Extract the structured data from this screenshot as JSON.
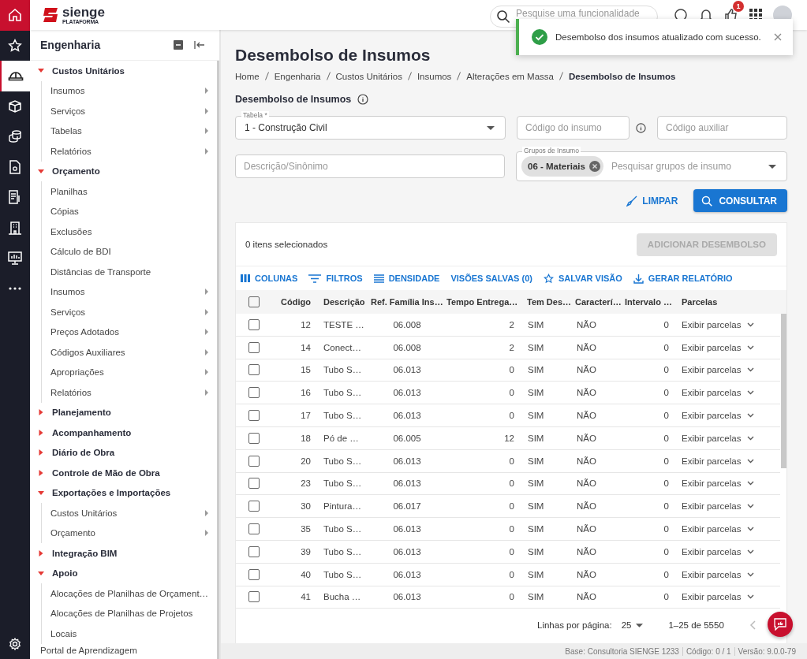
{
  "header": {
    "brand": "sienge",
    "brand_sub": "PLATAFORMA",
    "search": {
      "placeholder": "Pesquise uma funcionalidade"
    },
    "notification_badge": "1"
  },
  "rail": {
    "items": [
      {
        "selected": false
      },
      {
        "selected": false
      },
      {
        "selected": true
      },
      {
        "selected": false
      },
      {
        "selected": false
      },
      {
        "selected": false
      },
      {
        "selected": false
      },
      {
        "selected": false
      },
      {
        "selected": false
      },
      {
        "selected": false
      }
    ]
  },
  "sidebar": {
    "title": "Engenharia",
    "groups": [
      {
        "label": "Custos Unitários",
        "expanded": true,
        "children": [
          {
            "label": "Insumos",
            "has_submenu": true
          },
          {
            "label": "Serviços",
            "has_submenu": true
          },
          {
            "label": "Tabelas",
            "has_submenu": true
          },
          {
            "label": "Relatórios",
            "has_submenu": true
          }
        ]
      },
      {
        "label": "Orçamento",
        "expanded": true,
        "children": [
          {
            "label": "Planilhas",
            "has_submenu": false
          },
          {
            "label": "Cópias",
            "has_submenu": false
          },
          {
            "label": "Exclusões",
            "has_submenu": false
          },
          {
            "label": "Cálculo de BDI",
            "has_submenu": false
          },
          {
            "label": "Distâncias de Transporte",
            "has_submenu": false
          },
          {
            "label": "Insumos",
            "has_submenu": true
          },
          {
            "label": "Serviços",
            "has_submenu": true
          },
          {
            "label": "Preços Adotados",
            "has_submenu": true
          },
          {
            "label": "Códigos Auxiliares",
            "has_submenu": true
          },
          {
            "label": "Apropriações",
            "has_submenu": true
          },
          {
            "label": "Relatórios",
            "has_submenu": true
          }
        ]
      },
      {
        "label": "Planejamento",
        "expanded": false
      },
      {
        "label": "Acompanhamento",
        "expanded": false
      },
      {
        "label": "Diário de Obra",
        "expanded": false
      },
      {
        "label": "Controle de Mão de Obra",
        "expanded": false
      },
      {
        "label": "Exportações e Importações",
        "expanded": true,
        "children": [
          {
            "label": "Custos Unitários",
            "has_submenu": true
          },
          {
            "label": "Orçamento",
            "has_submenu": true
          }
        ]
      },
      {
        "label": "Integração BIM",
        "expanded": false
      },
      {
        "label": "Apoio",
        "expanded": true,
        "children": [
          {
            "label": "Alocações de Planilhas de Orçament…",
            "has_submenu": false
          },
          {
            "label": "Alocações de Planilhas de Projetos",
            "has_submenu": false
          },
          {
            "label": "Locais",
            "has_submenu": false
          }
        ]
      }
    ],
    "footer_link": "Portal de Aprendizagem"
  },
  "toast": {
    "message": "Desembolso dos insumos atualizado com sucesso."
  },
  "page": {
    "title": "Desembolso de Insumos",
    "breadcrumb": [
      {
        "label": "Home",
        "current": false
      },
      {
        "label": "Engenharia",
        "current": false
      },
      {
        "label": "Custos Unitários",
        "current": false
      },
      {
        "label": "Insumos",
        "current": false
      },
      {
        "label": "Alterações em Massa",
        "current": false
      },
      {
        "label": "Desembolso de Insumos",
        "current": true
      }
    ],
    "section_title": "Desembolso de Insumos"
  },
  "form": {
    "table_select": {
      "label": "Tabela *",
      "value": "1 - Construção Civil"
    },
    "item_code": {
      "placeholder": "Código do insumo"
    },
    "aux_code": {
      "placeholder": "Código auxiliar"
    },
    "description": {
      "placeholder": "Descrição/Sinônimo"
    },
    "groups": {
      "label": "Grupos de Insumo",
      "chips": [
        "06 - Materiais"
      ],
      "placeholder": "Pesquisar grupos de insumo"
    },
    "clear_button": "LIMPAR",
    "search_button": "CONSULTAR"
  },
  "table": {
    "selection_text": "0 itens selecionados",
    "add_button": {
      "label": "ADICIONAR DESEMBOLSO",
      "disabled": true
    },
    "toolbar": [
      "COLUNAS",
      "FILTROS",
      "DENSIDADE",
      "VISÕES SALVAS (0)",
      "SALVAR VISÃO",
      "GERAR RELATÓRIO"
    ],
    "select_all_checked": false,
    "columns": [
      "Código",
      "Descrição",
      "Ref. Família Ins…",
      "Tempo Entrega…",
      "Tem Des…",
      "Caracterí…",
      "Intervalo …",
      "Parcelas"
    ],
    "rows": [
      {
        "checked": false,
        "cells": [
          "12",
          "TESTE …",
          "06.008",
          "2",
          "SIM",
          "NÃO",
          "0",
          "Exibir parcelas"
        ]
      },
      {
        "checked": false,
        "cells": [
          "14",
          "Conect…",
          "06.008",
          "2",
          "SIM",
          "NÃO",
          "0",
          "Exibir parcelas"
        ]
      },
      {
        "checked": false,
        "cells": [
          "15",
          "Tubo S…",
          "06.013",
          "0",
          "SIM",
          "NÃO",
          "0",
          "Exibir parcelas"
        ]
      },
      {
        "checked": false,
        "cells": [
          "16",
          "Tubo S…",
          "06.013",
          "0",
          "SIM",
          "NÃO",
          "0",
          "Exibir parcelas"
        ]
      },
      {
        "checked": false,
        "cells": [
          "17",
          "Tubo S…",
          "06.013",
          "0",
          "SIM",
          "NÃO",
          "0",
          "Exibir parcelas"
        ]
      },
      {
        "checked": false,
        "cells": [
          "18",
          "Pó de …",
          "06.005",
          "12",
          "SIM",
          "NÃO",
          "0",
          "Exibir parcelas"
        ]
      },
      {
        "checked": false,
        "cells": [
          "20",
          "Tubo S…",
          "06.013",
          "0",
          "SIM",
          "NÃO",
          "0",
          "Exibir parcelas"
        ]
      },
      {
        "checked": false,
        "cells": [
          "23",
          "Tubo S…",
          "06.013",
          "0",
          "SIM",
          "NÃO",
          "0",
          "Exibir parcelas"
        ]
      },
      {
        "checked": false,
        "cells": [
          "30",
          "Pintura…",
          "06.017",
          "0",
          "SIM",
          "NÃO",
          "0",
          "Exibir parcelas"
        ]
      },
      {
        "checked": false,
        "cells": [
          "35",
          "Tubo S…",
          "06.013",
          "0",
          "SIM",
          "NÃO",
          "0",
          "Exibir parcelas"
        ]
      },
      {
        "checked": false,
        "cells": [
          "39",
          "Tubo S…",
          "06.013",
          "0",
          "SIM",
          "NÃO",
          "0",
          "Exibir parcelas"
        ]
      },
      {
        "checked": false,
        "cells": [
          "40",
          "Tubo S…",
          "06.013",
          "0",
          "SIM",
          "NÃO",
          "0",
          "Exibir parcelas"
        ]
      },
      {
        "checked": false,
        "cells": [
          "41",
          "Bucha …",
          "06.013",
          "0",
          "SIM",
          "NÃO",
          "0",
          "Exibir parcelas"
        ]
      }
    ],
    "pagination": {
      "rows_label": "Linhas por página:",
      "rows_value": "25",
      "range": "1–25 de 5550"
    }
  },
  "status_bar": [
    "Base: Consultoria SIENGE 1233",
    "Código: 0 / 1",
    "Versão: 9.0.0-79"
  ]
}
